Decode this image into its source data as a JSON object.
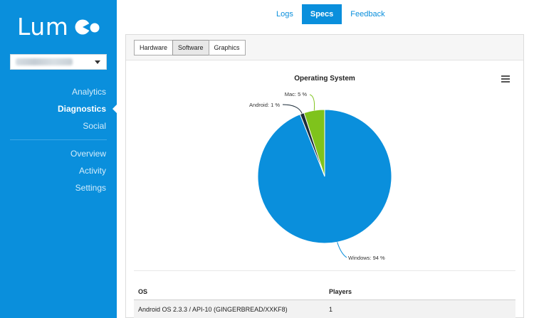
{
  "app": {
    "logo_text": "Lumos"
  },
  "sidebar": {
    "game_select": {
      "value_obscured": true
    },
    "nav_primary": [
      {
        "label": "Analytics"
      },
      {
        "label": "Diagnostics"
      },
      {
        "label": "Social"
      }
    ],
    "nav_secondary": [
      {
        "label": "Overview"
      },
      {
        "label": "Activity"
      },
      {
        "label": "Settings"
      }
    ],
    "active_item": "Diagnostics"
  },
  "top_tabs": [
    {
      "label": "Logs"
    },
    {
      "label": "Specs"
    },
    {
      "label": "Feedback"
    }
  ],
  "active_top_tab": "Specs",
  "sub_tabs": [
    {
      "label": "Hardware"
    },
    {
      "label": "Software"
    },
    {
      "label": "Graphics"
    }
  ],
  "active_sub_tab": "Software",
  "colors": {
    "brand": "#0a8fdc",
    "windows": "#0a8fdc",
    "android": "#1c2c3a",
    "mac": "#7fc31c"
  },
  "chart_data": {
    "type": "pie",
    "title": "Operating System",
    "slices": [
      {
        "label": "Windows",
        "value": 94,
        "display": "Windows: 94 %"
      },
      {
        "label": "Android",
        "value": 1,
        "display": "Android: 1 %"
      },
      {
        "label": "Mac",
        "value": 5,
        "display": "Mac: 5 %"
      }
    ]
  },
  "table": {
    "headers": {
      "os": "OS",
      "players": "Players"
    },
    "rows": [
      {
        "os": "Android OS 2.3.3 / API-10 (GINGERBREAD/XXKF8)",
        "players": "1"
      }
    ]
  }
}
